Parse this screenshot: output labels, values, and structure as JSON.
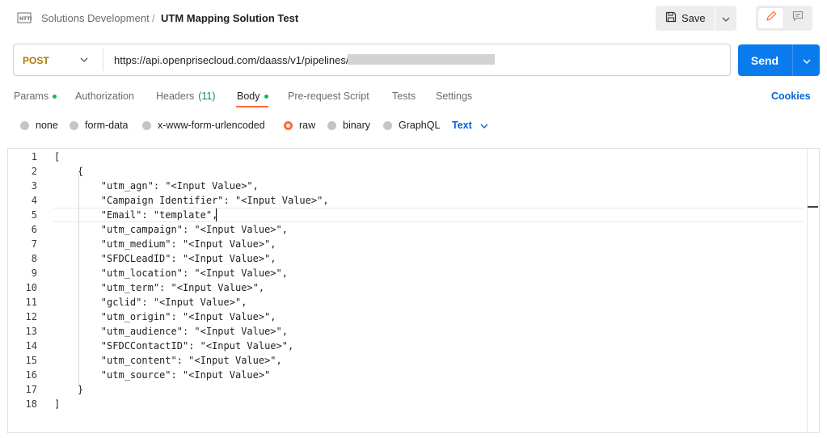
{
  "header": {
    "workspace": "Solutions Development",
    "separator": "/",
    "title": "UTM Mapping Solution Test",
    "save_label": "Save"
  },
  "request": {
    "method": "POST",
    "url": "https://api.openprisecloud.com/daass/v1/pipelines/",
    "send_label": "Send"
  },
  "tabs": [
    {
      "label": "Params",
      "dot": true
    },
    {
      "label": "Authorization"
    },
    {
      "label": "Headers",
      "count": "(11)"
    },
    {
      "label": "Body",
      "dot": true,
      "active": true
    },
    {
      "label": "Pre-request Script"
    },
    {
      "label": "Tests"
    },
    {
      "label": "Settings"
    }
  ],
  "cookies_label": "Cookies",
  "body_types": [
    {
      "label": "none"
    },
    {
      "label": "form-data"
    },
    {
      "label": "x-www-form-urlencoded"
    },
    {
      "label": "raw",
      "selected": true
    },
    {
      "label": "binary"
    },
    {
      "label": "GraphQL"
    }
  ],
  "raw_language": "Text",
  "editor": {
    "lines": [
      {
        "n": "1",
        "text": "["
      },
      {
        "n": "2",
        "text": "    {"
      },
      {
        "n": "3",
        "text": "        \"utm_agn\": \"<Input Value>\","
      },
      {
        "n": "4",
        "text": "        \"Campaign Identifier\": \"<Input Value>\","
      },
      {
        "n": "5",
        "text": "        \"Email\": \"template\","
      },
      {
        "n": "6",
        "text": "        \"utm_campaign\": \"<Input Value>\","
      },
      {
        "n": "7",
        "text": "        \"utm_medium\": \"<Input Value>\","
      },
      {
        "n": "8",
        "text": "        \"SFDCLeadID\": \"<Input Value>\","
      },
      {
        "n": "9",
        "text": "        \"utm_location\": \"<Input Value>\","
      },
      {
        "n": "10",
        "text": "        \"utm_term\": \"<Input Value>\","
      },
      {
        "n": "11",
        "text": "        \"gclid\": \"<Input Value>\","
      },
      {
        "n": "12",
        "text": "        \"utm_origin\": \"<Input Value>\","
      },
      {
        "n": "13",
        "text": "        \"utm_audience\": \"<Input Value>\","
      },
      {
        "n": "14",
        "text": "        \"SFDCContactID\": \"<Input Value>\","
      },
      {
        "n": "15",
        "text": "        \"utm_content\": \"<Input Value>\","
      },
      {
        "n": "16",
        "text": "        \"utm_source\": \"<Input Value>\""
      },
      {
        "n": "17",
        "text": "    }"
      },
      {
        "n": "18",
        "text": "]"
      }
    ]
  },
  "colors": {
    "accent": "#ff6c37",
    "send": "#097bed",
    "method": "#ad7a03",
    "link": "#0265d2",
    "status_dot": "#0cbb52"
  }
}
